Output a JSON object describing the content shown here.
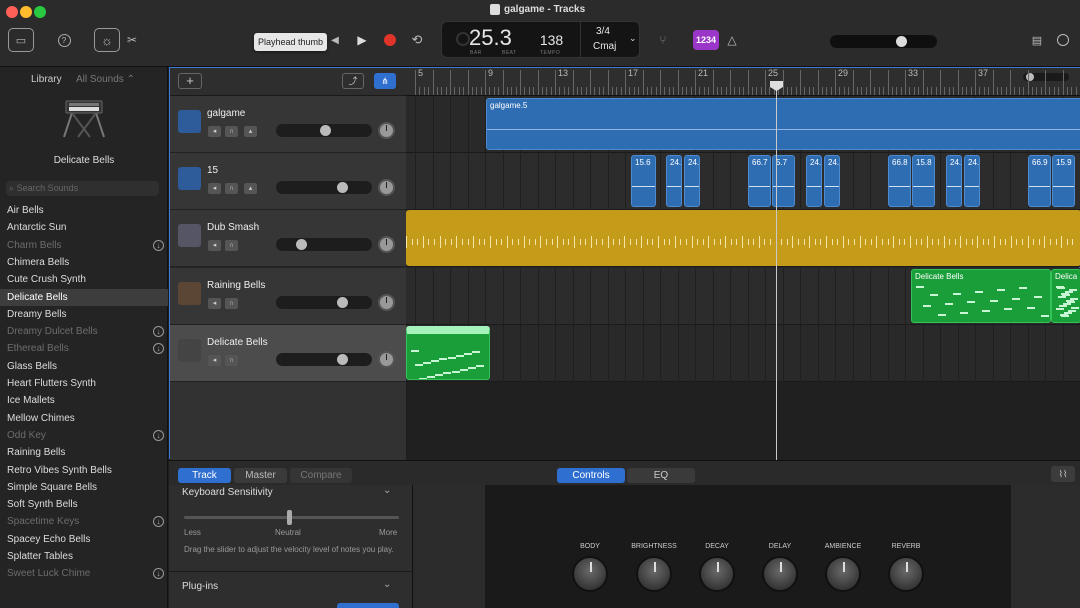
{
  "window": {
    "title": "galgame - Tracks"
  },
  "toolbar": {
    "tooltip": "Playhead thumb",
    "lcd": {
      "position": "25.3",
      "bar_label": "BAR",
      "beat_label": "BEAT",
      "tempo": "138",
      "tempo_label": "TEMPO",
      "time_signature": "3/4",
      "key": "Cmaj"
    },
    "count_in": "1234"
  },
  "library": {
    "title": "Library",
    "filter": "All Sounds",
    "selected_instrument": "Delicate Bells",
    "search_placeholder": "Search Sounds",
    "items": [
      {
        "label": "Air Bells",
        "dim": false
      },
      {
        "label": "Antarctic Sun",
        "dim": false
      },
      {
        "label": "Charm Bells",
        "dim": true
      },
      {
        "label": "Chimera Bells",
        "dim": false
      },
      {
        "label": "Cute Crush Synth",
        "dim": false
      },
      {
        "label": "Delicate Bells",
        "dim": false,
        "selected": true
      },
      {
        "label": "Dreamy Bells",
        "dim": false
      },
      {
        "label": "Dreamy Dulcet Bells",
        "dim": true
      },
      {
        "label": "Ethereal Bells",
        "dim": true
      },
      {
        "label": "Glass Bells",
        "dim": false
      },
      {
        "label": "Heart Flutters Synth",
        "dim": false
      },
      {
        "label": "Ice Mallets",
        "dim": false
      },
      {
        "label": "Mellow Chimes",
        "dim": false
      },
      {
        "label": "Odd Key",
        "dim": true
      },
      {
        "label": "Raining Bells",
        "dim": false
      },
      {
        "label": "Retro Vibes Synth Bells",
        "dim": false
      },
      {
        "label": "Simple Square Bells",
        "dim": false
      },
      {
        "label": "Soft Synth Bells",
        "dim": false
      },
      {
        "label": "Spacetime Keys",
        "dim": true
      },
      {
        "label": "Spacey Echo Bells",
        "dim": false
      },
      {
        "label": "Splatter Tables",
        "dim": false
      },
      {
        "label": "Sweet Luck Chime",
        "dim": true
      }
    ]
  },
  "ruler": {
    "bars": [
      "5",
      "9",
      "13",
      "17",
      "21",
      "25",
      "29",
      "33",
      "37"
    ]
  },
  "tracks": [
    {
      "name": "galgame",
      "volume": 0.52
    },
    {
      "name": "15",
      "volume": 0.72
    },
    {
      "name": "Dub Smash",
      "volume": 0.24
    },
    {
      "name": "Raining Bells",
      "volume": 0.72
    },
    {
      "name": "Delicate Bells",
      "volume": 0.72
    }
  ],
  "regions": {
    "audio": "galgame.5",
    "small": [
      "15.6",
      "24.",
      "24.",
      "66.7",
      "5.7",
      "24.",
      "24.",
      "66.8",
      "15.8",
      "24.",
      "24.",
      "66.9",
      "15.9"
    ],
    "raining1": "Delicate Bells",
    "raining2": "Delica"
  },
  "bottom": {
    "tabs": [
      "Track",
      "Master",
      "Compare"
    ],
    "center_tabs": [
      "Controls",
      "EQ"
    ],
    "kb_title": "Keyboard Sensitivity",
    "less": "Less",
    "neutral": "Neutral",
    "more": "More",
    "kb_desc": "Drag the slider to adjust the velocity level of notes you play.",
    "plugins": "Plug-ins",
    "knobs": [
      "BODY",
      "BRIGHTNESS",
      "DECAY",
      "DELAY",
      "AMBIENCE",
      "REVERB"
    ]
  },
  "colors": {
    "accent": "#2f6fcf",
    "audio_region": "#2f6db3",
    "midi_region": "#1a9e3a",
    "drummer_region": "#c59c1a"
  }
}
